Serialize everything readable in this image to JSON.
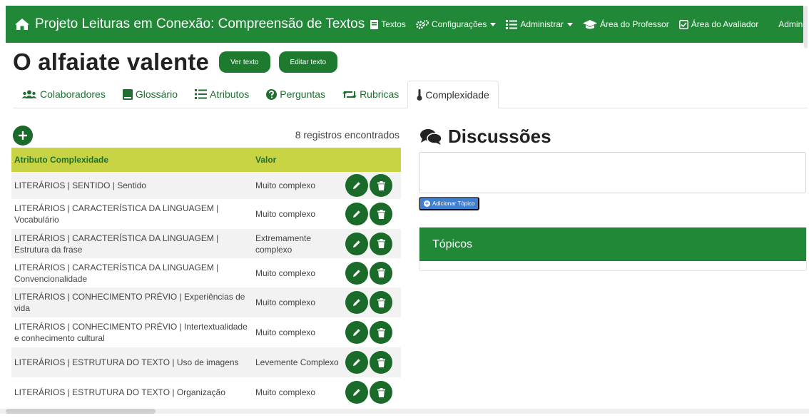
{
  "navbar": {
    "brand": "Projeto Leituras em Conexão: Compreensão de Textos",
    "items": [
      {
        "label": "Textos",
        "icon": "book-icon"
      },
      {
        "label": "Configurações",
        "icon": "cogs-icon"
      },
      {
        "label": "Administrar",
        "icon": "list-icon"
      },
      {
        "label": "Área do Professor",
        "icon": "graduation-cap-icon"
      },
      {
        "label": "Área do Avaliador",
        "icon": "check-square-icon"
      }
    ],
    "user": "Admin"
  },
  "page": {
    "title": "O alfaiate valente",
    "view_button": "Ver texto",
    "edit_button": "Editar texto"
  },
  "tabs": [
    {
      "label": "Colaboradores",
      "icon": "users-icon"
    },
    {
      "label": "Glossário",
      "icon": "book-icon"
    },
    {
      "label": "Atributos",
      "icon": "list-icon"
    },
    {
      "label": "Perguntas",
      "icon": "question-circle-icon"
    },
    {
      "label": "Rubricas",
      "icon": "retweet-icon"
    },
    {
      "label": "Complexidade",
      "icon": "thermometer-icon",
      "active": true
    }
  ],
  "complexity": {
    "records_text": "8 registros encontrados",
    "headers": {
      "attribute": "Atributo Complexidade",
      "value": "Valor"
    },
    "rows": [
      {
        "attribute": "LITERÁRIOS | SENTIDO | Sentido",
        "value": "Muito complexo"
      },
      {
        "attribute": "LITERÁRIOS | CARACTERÍSTICA DA LINGUAGEM | Vocabulário",
        "value": "Muito complexo"
      },
      {
        "attribute": "LITERÁRIOS | CARACTERÍSTICA DA LINGUAGEM | Estrutura da frase",
        "value": "Extremamente complexo"
      },
      {
        "attribute": "LITERÁRIOS | CARACTERÍSTICA DA LINGUAGEM | Convencionalidade",
        "value": "Muito complexo"
      },
      {
        "attribute": "LITERÁRIOS | CONHECIMENTO PRÉVIO | Experiências de vida",
        "value": "Muito complexo"
      },
      {
        "attribute": "LITERÁRIOS | CONHECIMENTO PRÉVIO | Intertextualidade e conhecimento cultural",
        "value": "Muito complexo"
      },
      {
        "attribute": "LITERÁRIOS | ESTRUTURA DO TEXTO | Uso de imagens",
        "value": "Levemente Complexo"
      },
      {
        "attribute": "LITERÁRIOS | ESTRUTURA DO TEXTO | Organização",
        "value": "Muito complexo"
      }
    ]
  },
  "discussions": {
    "title": "Discussões",
    "add_topic_button": "Adicionar Tópico",
    "topics_header": "Tópicos"
  },
  "colors": {
    "navbar": "#218838",
    "button_green": "#1d7a2f",
    "table_header": "#c8d443",
    "link_green": "#1e6f30",
    "topic_button": "#3f7fcf"
  }
}
